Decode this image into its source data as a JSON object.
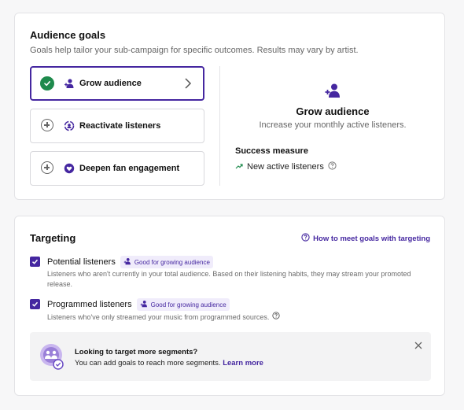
{
  "goals": {
    "title": "Audience goals",
    "subtitle": "Goals help tailor your sub-campaign for specific outcomes. Results may vary by artist.",
    "options": [
      {
        "label": "Grow audience",
        "selected": true,
        "icon": "person-add-icon"
      },
      {
        "label": "Reactivate listeners",
        "selected": false,
        "icon": "refresh-person-icon"
      },
      {
        "label": "Deepen fan engagement",
        "selected": false,
        "icon": "heart-icon"
      }
    ],
    "detail": {
      "title": "Grow audience",
      "description": "Increase your monthly active listeners.",
      "success_title": "Success measure",
      "success_value": "New active listeners"
    }
  },
  "targeting": {
    "title": "Targeting",
    "help_link": "How to meet goals with targeting",
    "segments": [
      {
        "label": "Potential listeners",
        "checked": true,
        "badge": "Good for growing audience",
        "description": "Listeners who aren't currently in your total audience. Based on their listening habits, they may stream your promoted release."
      },
      {
        "label": "Programmed listeners",
        "checked": true,
        "badge": "Good for growing audience",
        "description": "Listeners who've only streamed your music from programmed sources."
      }
    ],
    "banner": {
      "title": "Looking to target more segments?",
      "text": "You can add goals to reach more segments.",
      "link": "Learn more"
    }
  },
  "colors": {
    "accent": "#4527a0",
    "success": "#1e8a4c",
    "badge_bg": "#f0ecfb"
  }
}
